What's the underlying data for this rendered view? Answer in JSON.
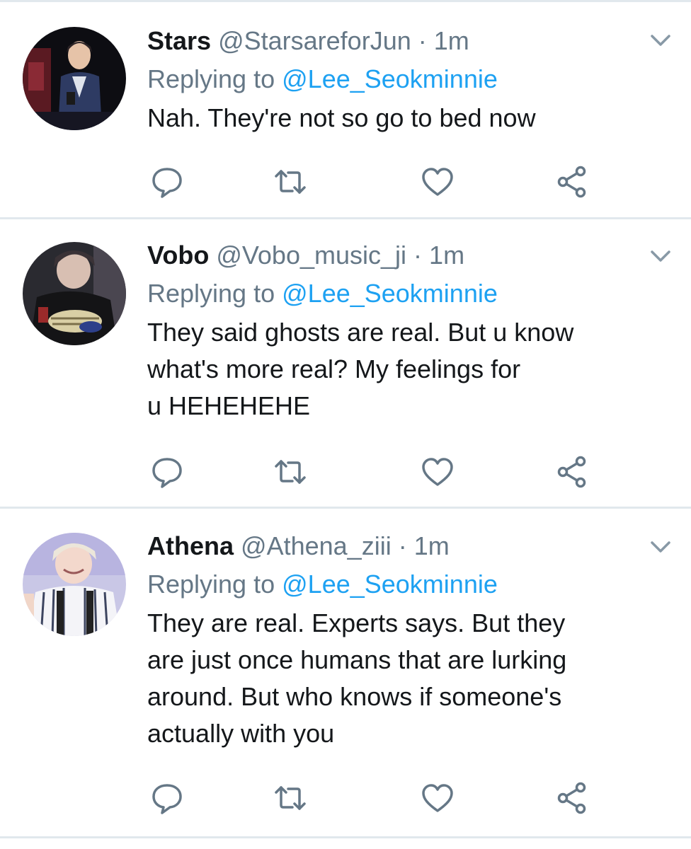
{
  "tweets": [
    {
      "display_name": "Stars",
      "handle": "@StarsareforJun",
      "separator": "·",
      "time": "1m",
      "replying_prefix": "Replying to",
      "replying_to": "@Lee_Seokminnie",
      "text": "Nah. They're not so go to bed now"
    },
    {
      "display_name": "Vobo",
      "handle": "@Vobo_music_ji",
      "separator": "·",
      "time": "1m",
      "replying_prefix": "Replying to",
      "replying_to": "@Lee_Seokminnie",
      "text_lines": [
        "They said ghosts are real. But u know",
        "what's more real? My feelings for",
        "u HEHEHEHE"
      ]
    },
    {
      "display_name": "Athena",
      "handle": "@Athena_ziii",
      "separator": "·",
      "time": "1m",
      "replying_prefix": "Replying to",
      "replying_to": "@Lee_Seokminnie",
      "text_lines": [
        "They are real. Experts says. But they",
        "are just once humans that are lurking",
        "around. But who knows if someone's",
        "actually with you"
      ]
    }
  ],
  "icons": {
    "reply": "reply-icon",
    "retweet": "retweet-icon",
    "like": "heart-icon",
    "share": "share-icon",
    "menu": "chevron-down-icon"
  },
  "colors": {
    "link": "#1da1f2",
    "secondary_text": "#657786",
    "primary_text": "#14171a",
    "icon": "#657786",
    "divider": "#e1e8ed"
  }
}
